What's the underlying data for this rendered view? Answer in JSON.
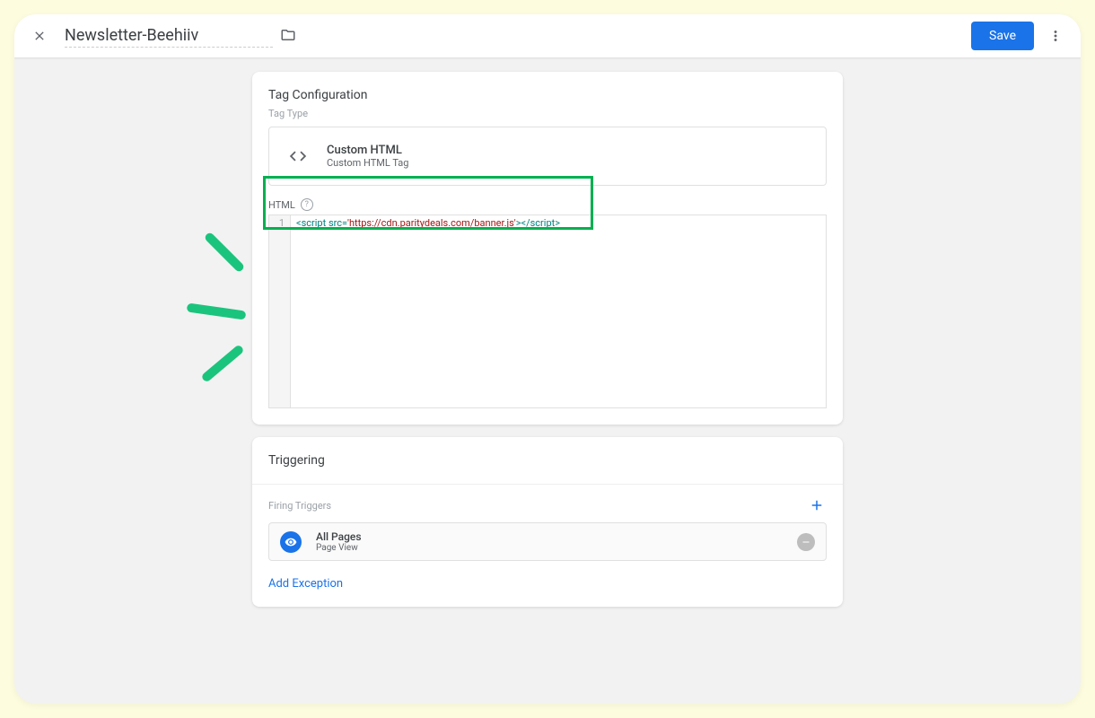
{
  "header": {
    "title": "Newsletter-Beehiiv",
    "save_label": "Save"
  },
  "tag_config": {
    "heading": "Tag Configuration",
    "type_label": "Tag Type",
    "type_name": "Custom HTML",
    "type_desc": "Custom HTML Tag",
    "html_label": "HTML",
    "code": {
      "line_number": "1",
      "open_tag": "<script",
      "attr": " src=",
      "q1": "'",
      "url": "https://cdn.paritydeals.com/banner.js",
      "q2": "'",
      "close_open": ">",
      "close_tag": "</script>"
    }
  },
  "triggering": {
    "heading": "Triggering",
    "firing_label": "Firing Triggers",
    "trigger": {
      "name": "All Pages",
      "type": "Page View"
    },
    "add_exception_label": "Add Exception"
  }
}
